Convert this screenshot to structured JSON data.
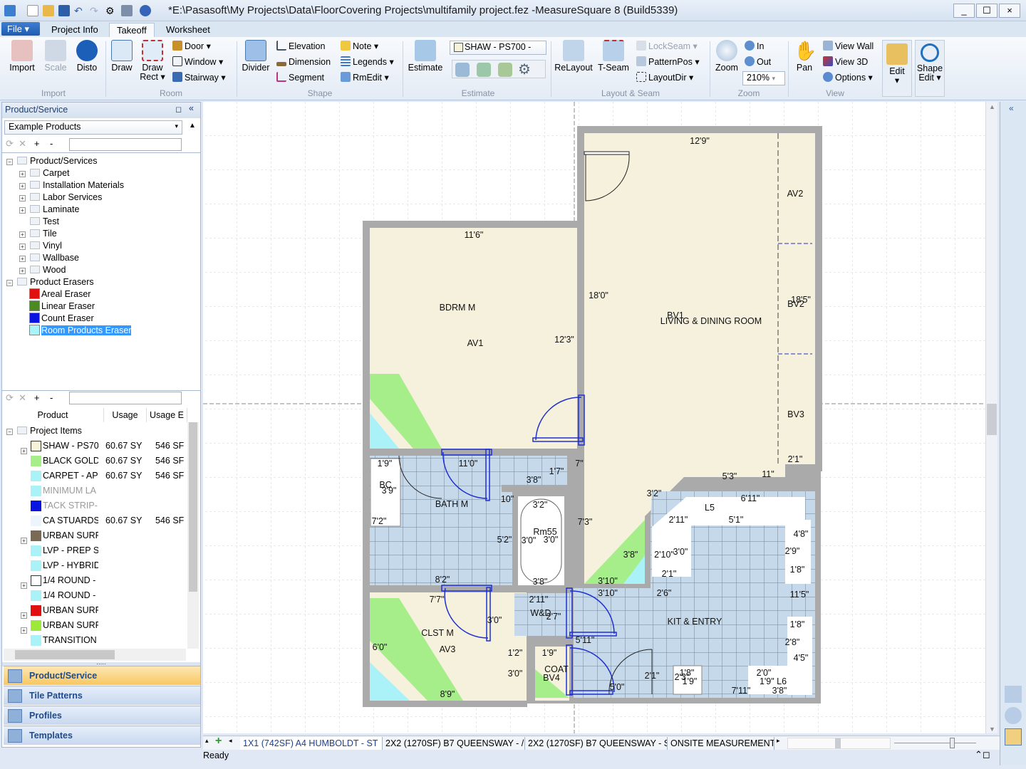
{
  "window": {
    "title": "*E:\\Pasasoft\\My Projects\\Data\\FloorCovering Projects\\multifamily project.fez -MeasureSquare 8 (Build5339)",
    "minimize": "_",
    "maximize": "☐",
    "close": "×"
  },
  "ribbon": {
    "file": "File ▾",
    "tabs": [
      "Project Info",
      "Takeoff",
      "Worksheet"
    ],
    "active_tab": "Takeoff",
    "import": {
      "label": "Import",
      "buttons": [
        "Import",
        "Scale",
        "Disto"
      ]
    },
    "room": {
      "label": "Room",
      "draw": "Draw",
      "draw_rect": "Draw Rect ▾",
      "door": "Door",
      "window": "Window",
      "stairway": "Stairway"
    },
    "shape": {
      "label": "Shape",
      "divider": "Divider",
      "elevation": "Elevation",
      "dimension": "Dimension",
      "segment": "Segment",
      "note": "Note",
      "legends": "Legends",
      "rmedit": "RmEdit ▾"
    },
    "estimate": {
      "label": "Estimate",
      "button": "Estimate",
      "product_select": "SHAW - PS700 -"
    },
    "layout": {
      "label": "Layout & Seam",
      "relayout": "ReLayout",
      "tseam": "T-Seam",
      "lockseam": "LockSeam",
      "patternpos": "PatternPos",
      "layoutdir": "LayoutDir"
    },
    "zoom": {
      "label": "Zoom",
      "zoom": "Zoom",
      "in": "In",
      "out": "Out",
      "level": "210%"
    },
    "view": {
      "label": "View",
      "pan": "Pan",
      "view_wall": "View Wall",
      "view_3d": "View 3D",
      "options": "Options ▾"
    },
    "edit": "Edit",
    "shape_edit": "Shape Edit ▾"
  },
  "left_panel": {
    "title": "Product/Service",
    "catalog": "Example Products",
    "tree": [
      {
        "label": "Product/Services",
        "level": 0,
        "exp": "-",
        "folder": true
      },
      {
        "label": "Carpet",
        "level": 1,
        "exp": "+",
        "folder": true
      },
      {
        "label": "Installation Materials",
        "level": 1,
        "exp": "+",
        "folder": true
      },
      {
        "label": "Labor Services",
        "level": 1,
        "exp": "+",
        "folder": true
      },
      {
        "label": "Laminate",
        "level": 1,
        "exp": "+",
        "folder": true
      },
      {
        "label": "Test",
        "level": 1,
        "exp": "",
        "folder": true
      },
      {
        "label": "Tile",
        "level": 1,
        "exp": "+",
        "folder": true
      },
      {
        "label": "Vinyl",
        "level": 1,
        "exp": "+",
        "folder": true
      },
      {
        "label": "Wallbase",
        "level": 1,
        "exp": "+",
        "folder": true
      },
      {
        "label": "Wood",
        "level": 1,
        "exp": "+",
        "folder": true
      },
      {
        "label": "Product Erasers",
        "level": 0,
        "exp": "-",
        "folder": true
      },
      {
        "label": "Areal Eraser",
        "level": 2,
        "color": "#e01010"
      },
      {
        "label": "Linear Eraser",
        "level": 2,
        "color": "#4a8a20"
      },
      {
        "label": "Count Eraser",
        "level": 2,
        "color": "#0a14e0"
      },
      {
        "label": "Room Products Eraser",
        "level": 2,
        "color": "#a8f4f8",
        "selected": true
      }
    ],
    "columns": [
      "Product",
      "Usage",
      "Usage E"
    ],
    "project_items": "Project Items",
    "rows": [
      {
        "exp": "+",
        "color": "#f6f3da",
        "name": "SHAW - PS70",
        "usage": "60.67 SY",
        "usage2": "546 SF"
      },
      {
        "exp": "",
        "color": "#a6ee8a",
        "name": "BLACK GOLD",
        "usage": "60.67 SY",
        "usage2": "546 SF"
      },
      {
        "exp": "",
        "color": "#aaf2f8",
        "name": "CARPET - AP",
        "usage": "60.67 SY",
        "usage2": "546 SF"
      },
      {
        "exp": "",
        "color": "#aaf2f8",
        "name": "MINIMUM LA",
        "usage": "",
        "usage2": "",
        "dim": true
      },
      {
        "exp": "",
        "color": "#0a14e0",
        "name": "TACK STRIP-",
        "usage": "",
        "usage2": "",
        "dim": true
      },
      {
        "exp": "",
        "color": "#eef4fb",
        "name": "CA STUARDS",
        "usage": "60.67 SY",
        "usage2": "546 SF"
      },
      {
        "exp": "+",
        "color": "#7a6a55",
        "name": "URBAN SURF",
        "usage": "",
        "usage2": ""
      },
      {
        "exp": "",
        "color": "#aaf2f8",
        "name": "LVP - PREP  S",
        "usage": "",
        "usage2": ""
      },
      {
        "exp": "",
        "color": "#aaf2f8",
        "name": "LVP - HYBRID",
        "usage": "",
        "usage2": ""
      },
      {
        "exp": "+",
        "color": "#ffffff",
        "name": "1/4 ROUND -",
        "usage": "",
        "usage2": ""
      },
      {
        "exp": "",
        "color": "#aaf2f8",
        "name": "1/4 ROUND -",
        "usage": "",
        "usage2": ""
      },
      {
        "exp": "+",
        "color": "#e01010",
        "name": "URBAN SURF",
        "usage": "",
        "usage2": ""
      },
      {
        "exp": "+",
        "color": "#9ee83a",
        "name": "URBAN SURF",
        "usage": "",
        "usage2": ""
      },
      {
        "exp": "",
        "color": "#aaf2f8",
        "name": "TRANSITION",
        "usage": "",
        "usage2": ""
      }
    ],
    "nav": [
      "Product/Service",
      "Tile Patterns",
      "Profiles",
      "Templates"
    ],
    "nav_active": "Product/Service"
  },
  "plan": {
    "labels": [
      "12'9\"",
      "AV2",
      "11'6\"",
      "BDRM M",
      "18'0\"",
      "BV1",
      "LIVING & DINING ROOM",
      "18'5\"",
      "BV2",
      "AV1",
      "12'3\"",
      "BV3",
      "2'1\"",
      "5'3\"",
      "11\"",
      "1'9\"",
      "11'0\"",
      "7\"",
      "1'7\"",
      "3'8\"",
      "BC",
      "3'9\"",
      "3'2\"",
      "6'11\"",
      "10\"",
      "3'2\"",
      "BATH M",
      "L5",
      "7'2\"",
      "7'3\"",
      "2'11\"",
      "5'1\"",
      "Rm55",
      "4'8\"",
      "5'2\"",
      "3'0\"",
      "3'0\"",
      "2'9\"",
      "3'8\"",
      "2'10\"",
      "3'0\"",
      "2'1\"",
      "1'8\"",
      "8'2\"",
      "3'8\"",
      "3'10\"",
      "3'10\"",
      "2'6\"",
      "11'5\"",
      "7'7\"",
      "2'11\"",
      "W&D",
      "2'7\"",
      "3'0\"",
      "KIT & ENTRY",
      "1'8\"",
      "CLST M",
      "5'11\"",
      "2'8\"",
      "AV3",
      "6'0\"",
      "1'2\"",
      "1'9\"",
      "4'5\"",
      "3'0\"",
      "COAT",
      "BV4",
      "2'1\"",
      "1'8\"",
      "2'3\"",
      "1'9\"",
      "2'0\"",
      "1'9\" L6",
      "5'0\"",
      "7'11\"",
      "3'8\"",
      "8'9\""
    ]
  },
  "bottom_tabs": [
    "1X1 (742SF) A4 HUMBOLDT - ST",
    "2X2 (1270SF) B7 QUEENSWAY - /",
    "2X2 (1270SF) B7 QUEENSWAY - S",
    "ONSITE MEASUREMENTS"
  ],
  "status": "Ready",
  "colors": {
    "accent": "#1d5cb2",
    "carpet": "#f5f1dc",
    "tile": "#c5d9ea",
    "wall": "#a9a9a9",
    "door": "#2030d0",
    "nav_active": "#f8c760"
  }
}
